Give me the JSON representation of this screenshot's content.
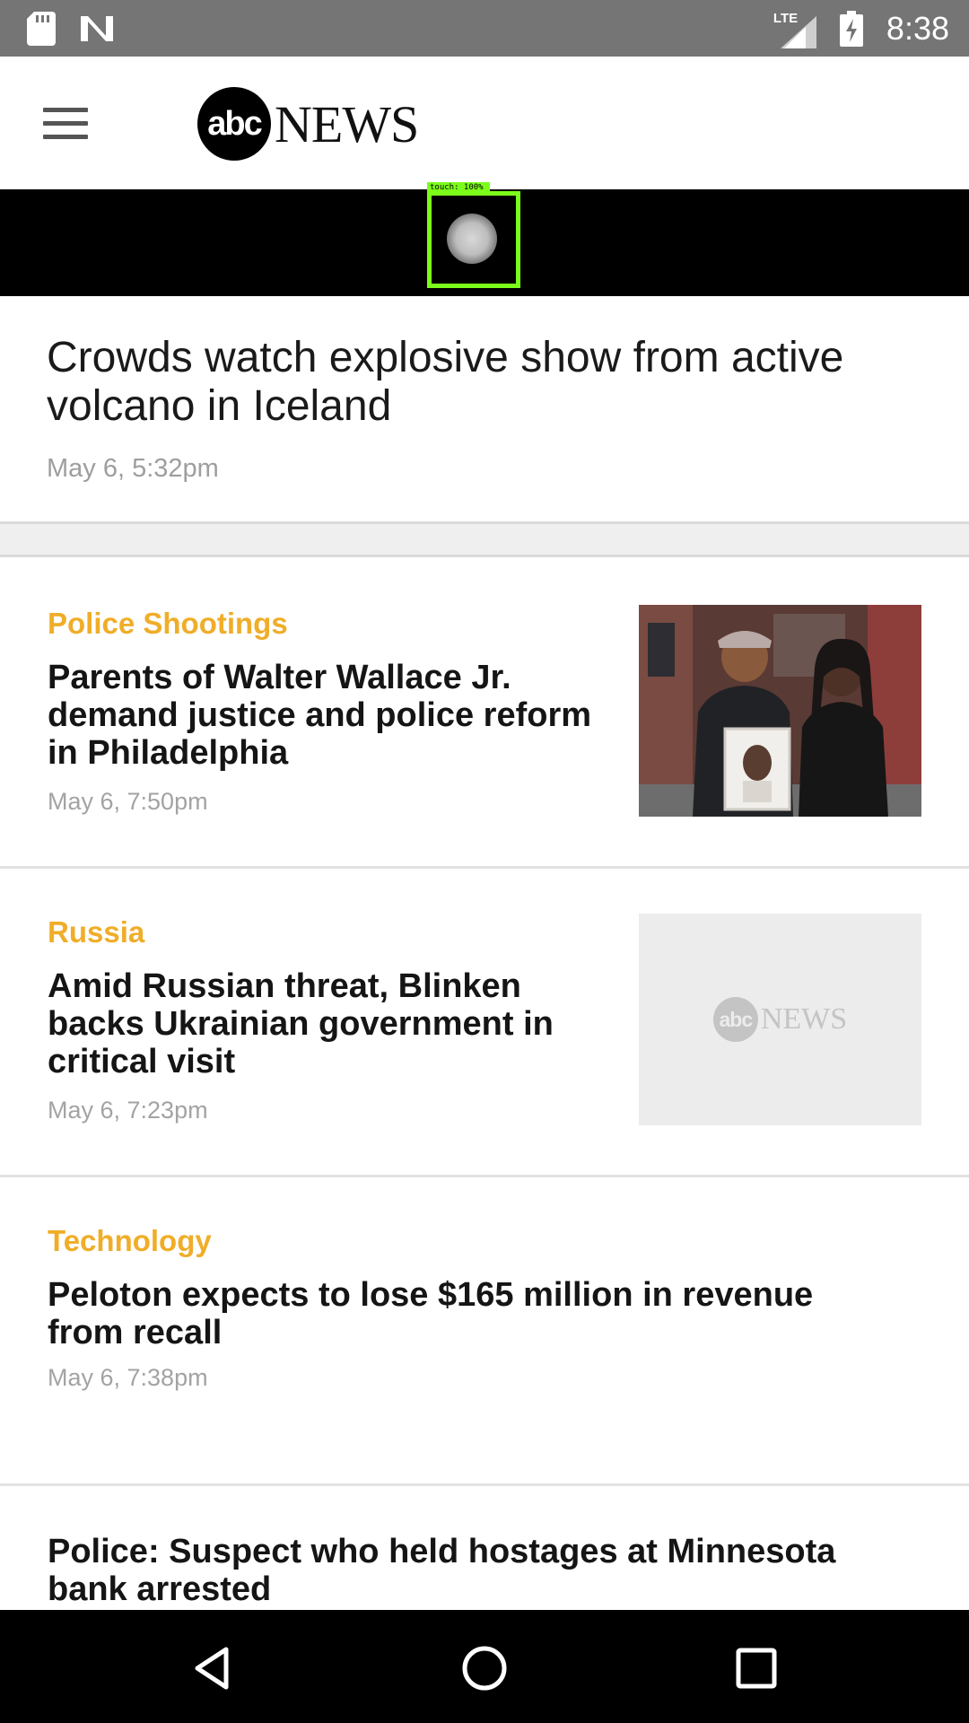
{
  "status_bar": {
    "network": "LTE",
    "time": "8:38"
  },
  "app": {
    "logo_circle_text": "abc",
    "logo_word": "NEWS"
  },
  "overlay": {
    "touch_label": "touch: 100%"
  },
  "headline": {
    "title": "Crowds watch explosive show from active volcano in Iceland",
    "time": "May 6, 5:32pm"
  },
  "stories": [
    {
      "category": "Police Shootings",
      "title": "Parents of Walter Wallace Jr. demand justice and police reform in Philadelphia",
      "time": "May 6, 7:50pm",
      "thumbnail": "photo"
    },
    {
      "category": "Russia",
      "title": "Amid Russian threat, Blinken backs Ukrainian government in critical visit",
      "time": "May 6, 7:23pm",
      "thumbnail": "placeholder",
      "placeholder_circle": "abc",
      "placeholder_word": "NEWS"
    },
    {
      "category": "Technology",
      "title": "Peloton expects to lose $165 million in revenue from recall",
      "time": "May 6, 7:38pm"
    },
    {
      "category": "",
      "title": "Police: Suspect who held hostages at Minnesota bank arrested"
    }
  ],
  "colors": {
    "category": "#f0ad28",
    "status_bar": "#757575",
    "touch_indicator": "#7cfc1a"
  }
}
